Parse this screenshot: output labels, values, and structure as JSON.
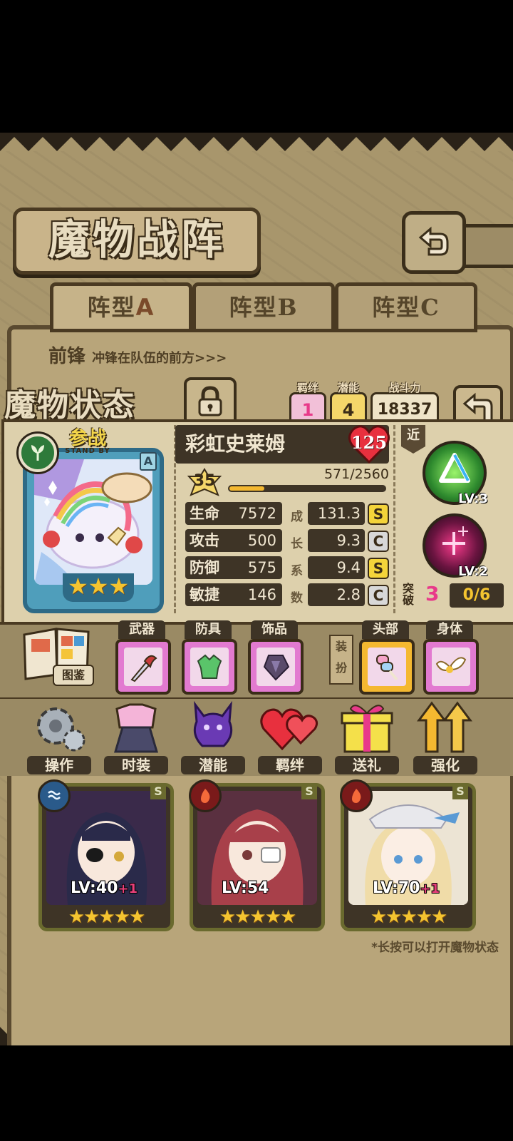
{
  "header": {
    "title": "魔物战阵"
  },
  "formation_tabs": [
    {
      "label_prefix": "阵型",
      "label_letter": "A"
    },
    {
      "label_prefix": "阵型",
      "label_letter": "B"
    },
    {
      "label_prefix": "阵型",
      "label_letter": "C"
    }
  ],
  "vanguard": {
    "title": "前锋",
    "desc": "冲锋在队伍的前方>>>"
  },
  "status_panel": {
    "title": "魔物状态",
    "bond": {
      "label": "羁绊",
      "value": "1"
    },
    "potential": {
      "label": "潜能",
      "value": "4"
    },
    "power": {
      "label": "战斗力",
      "value": "18337"
    }
  },
  "monster": {
    "name": "彩虹史莱姆",
    "hearts": "125",
    "standby_cn": "参战",
    "standby_en": "STAND BY",
    "rank": "A",
    "stars": "★★★",
    "level": "35",
    "exp_text": "571/2560",
    "exp_ratio": 0.223,
    "growth_label": [
      "成",
      "长",
      "系",
      "数"
    ],
    "stats": [
      {
        "name": "生命",
        "value": "7572",
        "growth": "131.3",
        "grade": "S"
      },
      {
        "name": "攻击",
        "value": "500",
        "growth": "9.3",
        "grade": "C"
      },
      {
        "name": "防御",
        "value": "575",
        "growth": "9.4",
        "grade": "S"
      },
      {
        "name": "敏捷",
        "value": "146",
        "growth": "2.8",
        "grade": "C"
      }
    ]
  },
  "skills": {
    "range": "近",
    "list": [
      {
        "lv": "LV:3"
      },
      {
        "lv": "LV:2"
      }
    ],
    "break_label": "突破",
    "break_num": "3",
    "break_frac": "0/6"
  },
  "equipment": {
    "encyclopedia": "图鉴",
    "slots": [
      {
        "tag": "武器"
      },
      {
        "tag": "防具"
      },
      {
        "tag": "饰品"
      }
    ],
    "dress_label": "装扮",
    "dress_slots": [
      {
        "tag": "头部"
      },
      {
        "tag": "身体"
      }
    ]
  },
  "actions": [
    {
      "label": "操作"
    },
    {
      "label": "时装"
    },
    {
      "label": "潜能"
    },
    {
      "label": "羁绊"
    },
    {
      "label": "送礼"
    },
    {
      "label": "强化"
    }
  ],
  "roster": [
    {
      "lv": "LV:40",
      "plus": "+1",
      "rank": "S",
      "stars": "★★★★★"
    },
    {
      "lv": "LV:54",
      "plus": "",
      "rank": "S",
      "stars": "★★★★★"
    },
    {
      "lv": "LV:70",
      "plus": "+1",
      "rank": "S",
      "stars": "★★★★★"
    }
  ],
  "hint": "*长按可以打开魔物状态",
  "colors": {
    "grade_S": "#f4d43a",
    "grade_C": "#d8d8d8",
    "bond": "#e83a8a",
    "potential": "#f4c430"
  }
}
